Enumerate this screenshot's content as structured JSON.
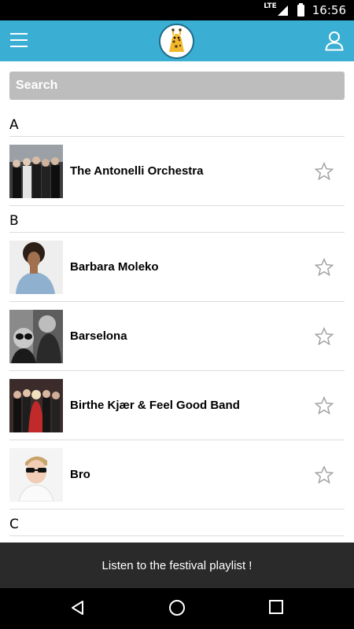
{
  "status_bar": {
    "network": "LTE",
    "time": "16:56"
  },
  "app_bar": {
    "menu_icon": "hamburger-menu-icon",
    "logo": "giraffe-logo",
    "user_icon": "user-profile-icon"
  },
  "search": {
    "placeholder": "Search",
    "value": ""
  },
  "sections": [
    {
      "letter": "A",
      "artists": [
        {
          "name": "The Antonelli Orchestra",
          "favorite": false
        }
      ]
    },
    {
      "letter": "B",
      "artists": [
        {
          "name": "Barbara Moleko",
          "favorite": false
        },
        {
          "name": "Barselona",
          "favorite": false
        },
        {
          "name": "Birthe Kjær & Feel Good Band",
          "favorite": false
        },
        {
          "name": "Bro",
          "favorite": false
        }
      ]
    },
    {
      "letter": "C",
      "artists": []
    }
  ],
  "playlist_bar": {
    "label": "Listen to the festival playlist !"
  },
  "colors": {
    "app_bar": "#3aafd3",
    "search_bg": "#bdbdbd",
    "playlist_bar": "#2a2a2a"
  }
}
